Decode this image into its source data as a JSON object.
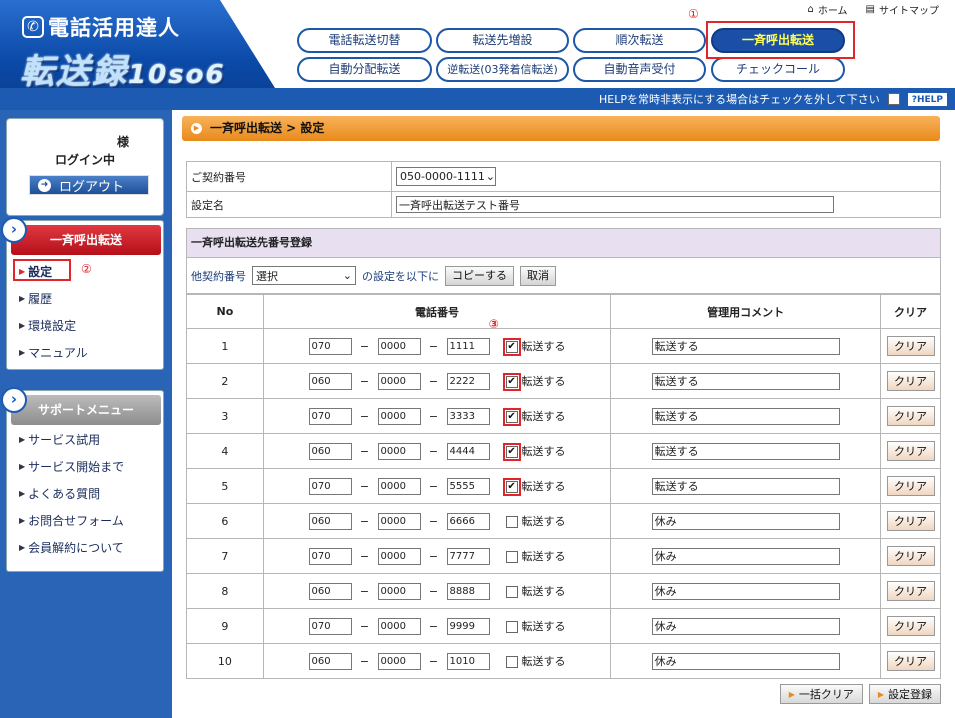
{
  "logo": {
    "line1": "電話活用達人",
    "line2": "転送録",
    "version": "10so6",
    "phone_icon": "phone-icon"
  },
  "top_links": [
    {
      "label": "ホーム",
      "icon": "home-icon"
    },
    {
      "label": "サイトマップ",
      "icon": "sitemap-icon"
    }
  ],
  "nav": {
    "row1": [
      "電話転送切替",
      "転送先増設",
      "順次転送",
      "一斉呼出転送"
    ],
    "row2": [
      "自動分配転送",
      "逆転送(03発着信転送)",
      "自動音声受付",
      "チェックコール"
    ],
    "active": "一斉呼出転送"
  },
  "help_bar": {
    "text": "HELPを常時非表示にする場合はチェックを外して下さい",
    "button": "?HELP"
  },
  "annotations": {
    "n1": "①",
    "n2": "②",
    "n3": "③"
  },
  "user": {
    "sama": "様",
    "status": "ログイン中",
    "logout": "ログアウト"
  },
  "menu": {
    "header": "一斉呼出転送",
    "items": [
      "設定",
      "履歴",
      "環境設定",
      "マニュアル"
    ],
    "active": "設定"
  },
  "support": {
    "header": "サポートメニュー",
    "items": [
      "サービス試用",
      "サービス開始まで",
      "よくある質問",
      "お問合せフォーム",
      "会員解約について"
    ]
  },
  "breadcrumb": "一斉呼出転送 > 設定",
  "info": {
    "contract_label": "ご契約番号",
    "contract_value": "050-0000-1111",
    "name_label": "設定名",
    "name_value": "一斉呼出転送テスト番号"
  },
  "registration": {
    "header": "一斉呼出転送先番号登録",
    "other_label": "他契約番号",
    "other_select": "選択",
    "other_suffix": "の設定を以下に",
    "copy_button": "コピーする",
    "cancel_button": "取消"
  },
  "table": {
    "headers": [
      "No",
      "電話番号",
      "管理用コメント",
      "クリア"
    ],
    "forward_label": "転送する",
    "clear_label": "クリア",
    "dash": "−",
    "rows": [
      {
        "no": "1",
        "p1": "070",
        "p2": "0000",
        "p3": "1111",
        "checked": true,
        "comment": "転送する"
      },
      {
        "no": "2",
        "p1": "060",
        "p2": "0000",
        "p3": "2222",
        "checked": true,
        "comment": "転送する"
      },
      {
        "no": "3",
        "p1": "070",
        "p2": "0000",
        "p3": "3333",
        "checked": true,
        "comment": "転送する"
      },
      {
        "no": "4",
        "p1": "060",
        "p2": "0000",
        "p3": "4444",
        "checked": true,
        "comment": "転送する"
      },
      {
        "no": "5",
        "p1": "070",
        "p2": "0000",
        "p3": "5555",
        "checked": true,
        "comment": "転送する"
      },
      {
        "no": "6",
        "p1": "060",
        "p2": "0000",
        "p3": "6666",
        "checked": false,
        "comment": "休み"
      },
      {
        "no": "7",
        "p1": "070",
        "p2": "0000",
        "p3": "7777",
        "checked": false,
        "comment": "休み"
      },
      {
        "no": "8",
        "p1": "060",
        "p2": "0000",
        "p3": "8888",
        "checked": false,
        "comment": "休み"
      },
      {
        "no": "9",
        "p1": "070",
        "p2": "0000",
        "p3": "9999",
        "checked": false,
        "comment": "休み"
      },
      {
        "no": "10",
        "p1": "060",
        "p2": "0000",
        "p3": "1010",
        "checked": false,
        "comment": "休み"
      }
    ]
  },
  "footer": {
    "clear_all": "一括クリア",
    "register": "設定登録"
  },
  "colors": {
    "accent": "#1d5bb3",
    "active_nav": "#1b4ea6",
    "highlight": "#e0262b",
    "orange": "#e88a1c"
  }
}
